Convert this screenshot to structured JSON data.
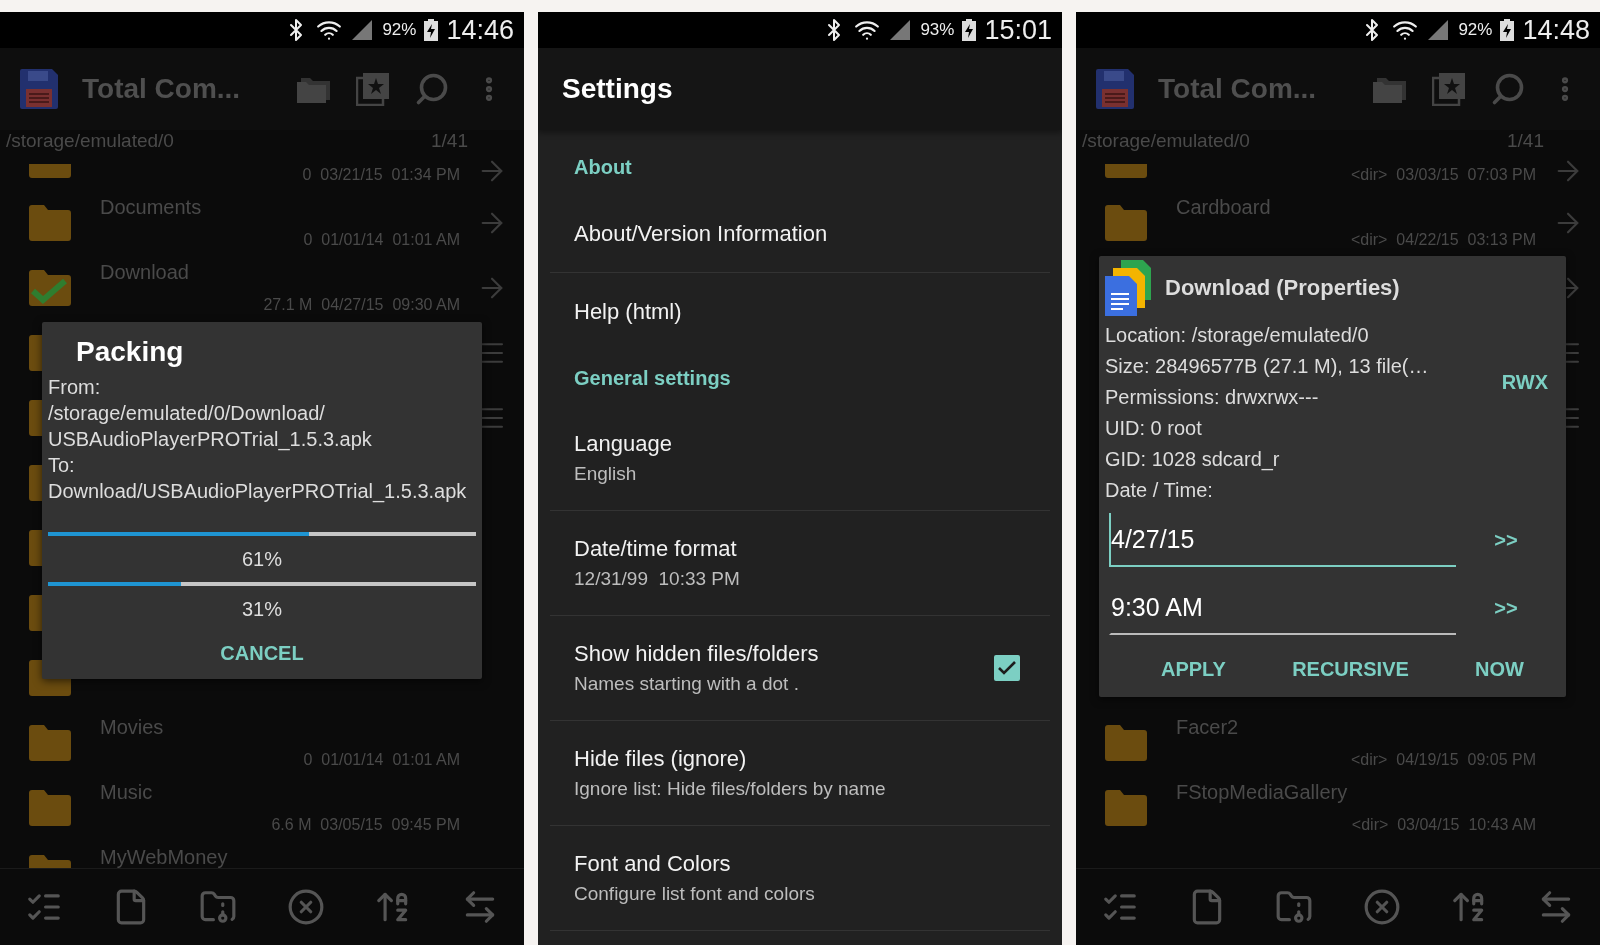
{
  "phones": [
    {
      "kind": "files",
      "status": {
        "battery": "92%",
        "time": "14:46"
      },
      "app_bar": {
        "title": "Total Com..."
      },
      "path": "/storage/emulated/0",
      "count": "1/41",
      "rows": [
        {
          "kind": "partial",
          "meta": "0  03/21/15  01:34 PM",
          "end_icon": {
            "kind": "arrow"
          },
          "checked": false
        },
        {
          "kind": "entry",
          "name": "Documents",
          "meta": "0  01/01/14  01:01 AM",
          "end_icon": {
            "kind": "arrow"
          },
          "checked": false
        },
        {
          "kind": "entry",
          "name": "Download",
          "meta": "27.1 M  04/27/15  09:30 AM",
          "end_icon": {
            "kind": "arrow"
          },
          "checked": true
        },
        {
          "kind": "covered",
          "end_icon": {
            "kind": "menu"
          },
          "checked": false
        },
        {
          "kind": "covered",
          "end_icon": {
            "kind": "menu"
          },
          "checked": false
        },
        {
          "kind": "covered",
          "checked": false
        },
        {
          "kind": "covered",
          "checked": false
        },
        {
          "kind": "covered",
          "checked": false
        },
        {
          "kind": "covered",
          "checked": false
        },
        {
          "kind": "entry",
          "name": "Movies",
          "meta": "0  01/01/14  01:01 AM",
          "checked": false
        },
        {
          "kind": "entry",
          "name": "Music",
          "meta": "6.6 M  03/05/15  09:45 PM",
          "checked": false
        },
        {
          "kind": "entry",
          "name": "MyWebMoney",
          "checked": false
        }
      ],
      "dialog": {
        "kind": "packing",
        "title": "Packing",
        "lines": [
          "From:",
          "/storage/emulated/0/Download/",
          "USBAudioPlayerPROTrial_1.5.3.apk",
          "To:",
          "Download/USBAudioPlayerPROTrial_1.5.3.apk"
        ],
        "progress": [
          {
            "level": 0.61,
            "reading": "61%"
          },
          {
            "level": 0.31,
            "reading": "31%"
          }
        ],
        "buttons": [
          "CANCEL"
        ]
      }
    },
    {
      "kind": "settings",
      "status": {
        "battery": "93%",
        "time": "15:01"
      },
      "title": "Settings",
      "items": [
        {
          "kind": "header",
          "title": "About"
        },
        {
          "kind": "item",
          "title": "About/Version Information"
        },
        {
          "kind": "item",
          "title": "Help (html)"
        },
        {
          "kind": "header",
          "title": "General settings"
        },
        {
          "kind": "item",
          "title": "Language",
          "subtitle": "English"
        },
        {
          "kind": "item",
          "title": "Date/time format",
          "subtitle": "12/31/99  10:33 PM"
        },
        {
          "kind": "check",
          "title": "Show hidden files/folders",
          "subtitle": "Names starting with a dot .",
          "checked": true
        },
        {
          "kind": "item",
          "title": "Hide files (ignore)",
          "subtitle": "Ignore list: Hide files/folders by name"
        },
        {
          "kind": "item",
          "title": "Font and Colors",
          "subtitle": "Configure list font and colors"
        }
      ]
    },
    {
      "kind": "files",
      "status": {
        "battery": "92%",
        "time": "14:48"
      },
      "app_bar": {
        "title": "Total Com..."
      },
      "path": "/storage/emulated/0",
      "count": "1/41",
      "rows": [
        {
          "kind": "partial",
          "meta": "<dir>  03/03/15  07:03 PM",
          "end_icon": {
            "kind": "arrow"
          },
          "checked": false
        },
        {
          "kind": "entry",
          "name": "Cardboard",
          "meta": "<dir>  04/22/15  03:13 PM",
          "end_icon": {
            "kind": "arrow"
          },
          "checked": false
        },
        {
          "kind": "edge",
          "end_icon": {
            "kind": "arrow"
          }
        },
        {
          "kind": "edge",
          "end_icon": {
            "kind": "menu"
          }
        },
        {
          "kind": "edge",
          "end_icon": {
            "kind": "menu"
          }
        },
        {
          "kind": "edge"
        },
        {
          "kind": "edge"
        },
        {
          "kind": "edge"
        },
        {
          "kind": "edge"
        },
        {
          "kind": "entry",
          "name": "Facer2",
          "meta": "<dir>  04/19/15  09:05 PM",
          "checked": false
        },
        {
          "kind": "entry",
          "name": "FStopMediaGallery",
          "meta": "<dir>  03/04/15  10:43 AM",
          "checked": false
        }
      ],
      "dialog": {
        "kind": "properties",
        "title": "Download (Properties)",
        "lines": [
          "Location: /storage/emulated/0",
          "Size: 28496577B (27.1 M), 13 file(…",
          "Permissions: drwxrwx---",
          "UID: 0 root",
          "GID: 1028 sdcard_r",
          "Date / Time:"
        ],
        "side_button": "RWX",
        "fields": [
          {
            "value": "4/27/15",
            "focused": true,
            "button": ">>"
          },
          {
            "value": "9:30 AM",
            "focused": false,
            "button": ">>"
          }
        ],
        "buttons": [
          "APPLY",
          "RECURSIVE",
          "NOW"
        ]
      }
    }
  ]
}
